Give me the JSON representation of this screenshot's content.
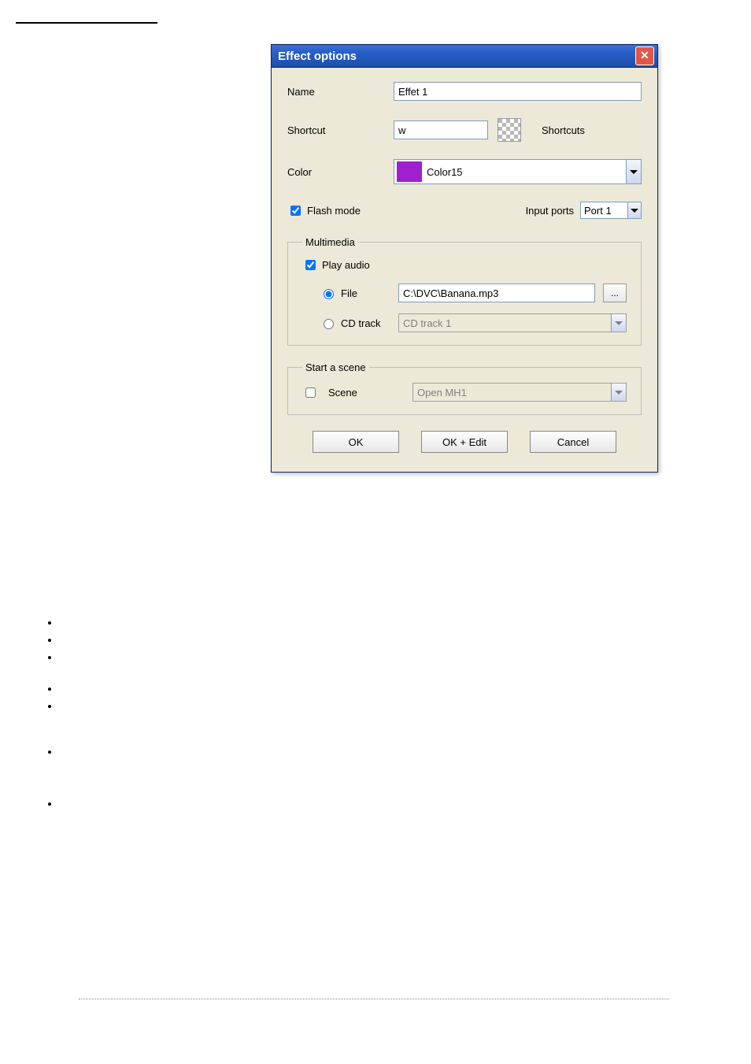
{
  "dialog": {
    "title": "Effect options",
    "name_label": "Name",
    "name_value": "Effet 1",
    "shortcut_label": "Shortcut",
    "shortcut_value": "w",
    "shortcuts_btn": "Shortcuts",
    "color_label": "Color",
    "color_name": "Color15",
    "color_hex": "#a020d0",
    "flashmode_label": "Flash mode",
    "flashmode_checked": true,
    "inputports_label": "Input ports",
    "inputports_value": "Port 1",
    "multimedia": {
      "legend": "Multimedia",
      "playaudio_label": "Play audio",
      "playaudio_checked": true,
      "file_label": "File",
      "file_selected": true,
      "file_path": "C:\\DVC\\Banana.mp3",
      "browse_label": "...",
      "cdtrack_label": "CD track",
      "cdtrack_selected": false,
      "cdtrack_value": "CD track 1"
    },
    "startscene": {
      "legend": "Start a scene",
      "scene_label": "Scene",
      "scene_checked": false,
      "scene_value": "Open MH1"
    },
    "buttons": {
      "ok": "OK",
      "ok_edit": "OK + Edit",
      "cancel": "Cancel"
    }
  }
}
